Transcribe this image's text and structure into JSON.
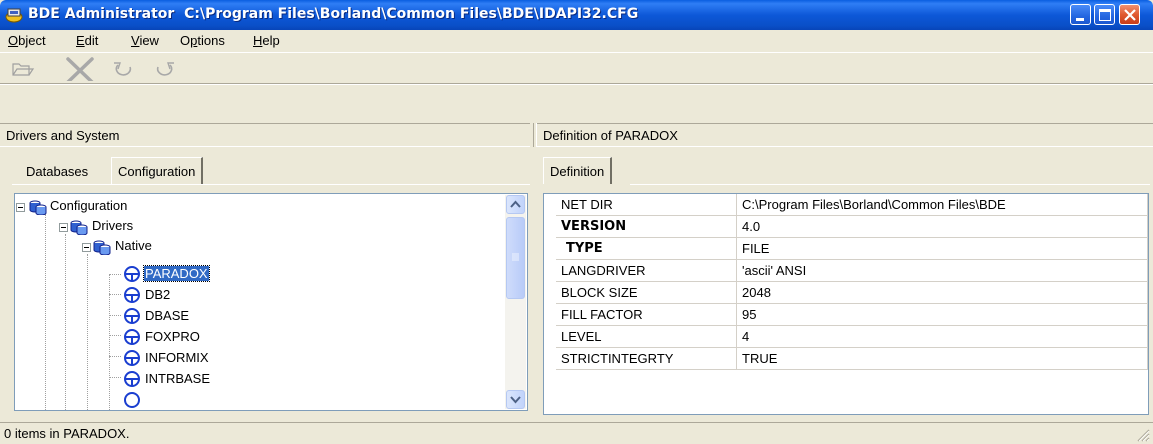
{
  "window": {
    "title": "BDE Administrator  C:\\Program Files\\Borland\\Common Files\\BDE\\IDAPI32.CFG"
  },
  "menu": {
    "items": [
      {
        "key": "O",
        "rest": "bject"
      },
      {
        "key": "E",
        "rest": "dit"
      },
      {
        "key": "V",
        "rest": "iew"
      },
      {
        "key": "p",
        "pre": "O",
        "rest": "tions"
      },
      {
        "key": "H",
        "rest": "elp"
      }
    ]
  },
  "toolbar": {
    "buttons": [
      "open-icon",
      "delete-icon",
      "undo-icon",
      "redo-icon"
    ]
  },
  "left_pane": {
    "header": "Drivers and System",
    "tabs": [
      "Databases",
      "Configuration"
    ],
    "active_tab": "Configuration",
    "tree": [
      {
        "label": "Configuration",
        "level": 0,
        "icon": "configuration-icon"
      },
      {
        "label": "Drivers",
        "level": 1,
        "icon": "drivers-icon"
      },
      {
        "label": "Native",
        "level": 2,
        "icon": "native-icon"
      },
      {
        "label": "PARADOX",
        "level": 3,
        "icon": "driver-icon",
        "selected": true
      },
      {
        "label": "DB2",
        "level": 3,
        "icon": "driver-icon"
      },
      {
        "label": "DBASE",
        "level": 3,
        "icon": "driver-icon"
      },
      {
        "label": "FOXPRO",
        "level": 3,
        "icon": "driver-icon"
      },
      {
        "label": "INFORMIX",
        "level": 3,
        "icon": "driver-icon"
      },
      {
        "label": "INTRBASE",
        "level": 3,
        "icon": "driver-icon"
      }
    ]
  },
  "right_pane": {
    "header": "Definition of PARADOX",
    "tabs": [
      "Definition"
    ],
    "rows": [
      {
        "name": "NET DIR",
        "value": "C:\\Program Files\\Borland\\Common Files\\BDE",
        "bold": false
      },
      {
        "name": "VERSION",
        "value": "4.0",
        "bold": true
      },
      {
        "name": "TYPE",
        "value": "FILE",
        "bold": true
      },
      {
        "name": "LANGDRIVER",
        "value": "'ascii' ANSI",
        "bold": false
      },
      {
        "name": "BLOCK SIZE",
        "value": "2048",
        "bold": false
      },
      {
        "name": "FILL FACTOR",
        "value": "95",
        "bold": false
      },
      {
        "name": "LEVEL",
        "value": "4",
        "bold": false
      },
      {
        "name": "STRICTINTEGRTY",
        "value": "TRUE",
        "bold": false
      }
    ]
  },
  "status": {
    "text": "0 items in PARADOX."
  },
  "colors": {
    "titlebar": "#0a4fc8",
    "selection": "#316ac5",
    "face": "#ece9d8"
  }
}
